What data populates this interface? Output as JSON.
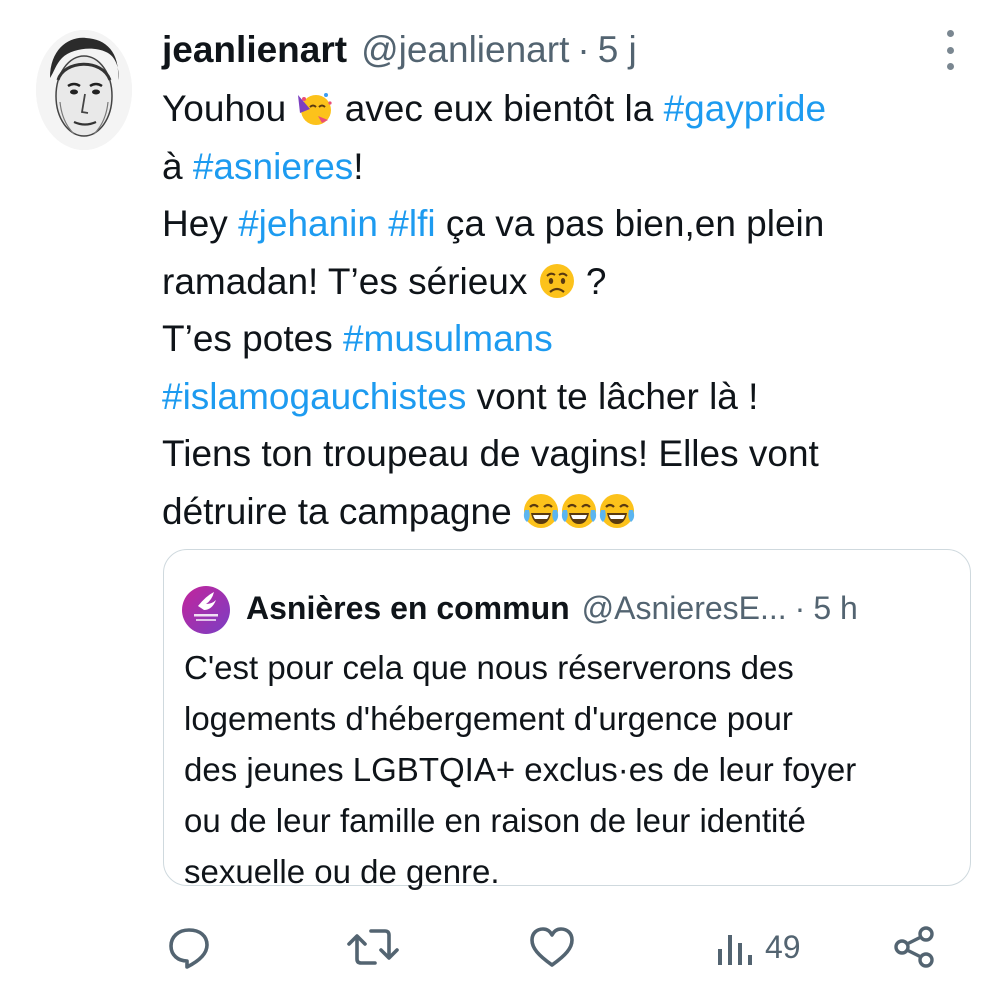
{
  "tweet": {
    "display_name": "jeanlienart",
    "handle": "@jeanlienart",
    "separator": "·",
    "time": "5 j",
    "avatar_icon": "user-portrait-avatar",
    "more_icon": "more-options-icon",
    "text": {
      "line1": {
        "t1": "Youhou",
        "t2": " avec eux bientôt la ",
        "tag": "#gaypride"
      },
      "line2": {
        "t1": "à ",
        "tag": "#asnieres",
        "t2": "!"
      },
      "line3": {
        "t1": "Hey ",
        "tag1": "#jehanin",
        "t2": " ",
        "tag2": "#lfi",
        "t3": " ça va pas bien,en plein"
      },
      "line4": {
        "t1": "ramadan! T’es sérieux ",
        "t2": " ?"
      },
      "line5": {
        "t1": "T’es potes ",
        "tag": "#musulmans"
      },
      "line6": {
        "tag": "#islamogauchistes",
        "t1": " vont te lâcher là !"
      },
      "line7": {
        "t1": "Tiens ton troupeau de vagins! Elles vont"
      },
      "line8": {
        "t1": "détruire ta campagne "
      }
    },
    "emojis": [
      "partying-face",
      "worried-face",
      "joy-face",
      "joy-face",
      "joy-face"
    ]
  },
  "quote": {
    "display_name": "Asnières en commun",
    "handle": "@AsnieresE...",
    "separator": "·",
    "time": "5 h",
    "lines": [
      "C'est pour cela que nous réserverons des",
      "logements d'hébergement d'urgence pour",
      "des jeunes LGBTQIA+ exclus·es de leur foyer",
      "ou de leur famille en raison de leur identité",
      "sexuelle ou de genre."
    ]
  },
  "actions": {
    "reply_icon": "reply-icon",
    "retweet_icon": "retweet-icon",
    "like_icon": "heart-icon",
    "views_icon": "views-icon",
    "views_count": "49",
    "share_icon": "share-icon"
  },
  "colors": {
    "link": "#1d9bf0",
    "secondary": "#536471",
    "text": "#0f1419",
    "border": "#cfd9de"
  }
}
